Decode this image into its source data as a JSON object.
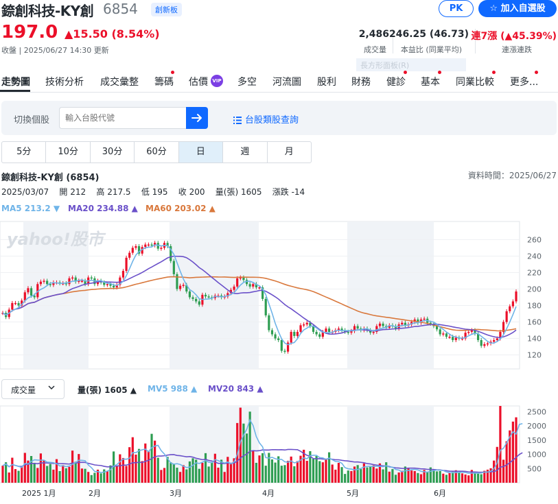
{
  "header": {
    "name": "錼創科技-KY創",
    "code": "6854",
    "board": "創新板",
    "pk": "PK",
    "add_watch": "☆ 加入自選股"
  },
  "quote": {
    "price": "197.0",
    "change": "▲15.50 (8.54%)",
    "updated": "收盤 | 2025/06/27 14:30 更新",
    "volume": "2,486",
    "volume_label": "成交量",
    "pe": "246.25 (46.73)",
    "pe_label": "本益比 (同業平均)",
    "streak": "連7漲 (▲45.39%)",
    "streak_label": "連漲連跌",
    "ghost": "長方形面板(R)"
  },
  "nav": [
    "走勢圖",
    "技術分析",
    "成交彙整",
    "籌碼",
    "估價",
    "多空",
    "河流圖",
    "股利",
    "財務",
    "健診",
    "基本",
    "同業比較",
    "更多..."
  ],
  "nav_vip": "VIP",
  "search": {
    "label": "切換個股",
    "placeholder": "輸入台股代號",
    "category_link": "台股類股查詢"
  },
  "ranges": [
    "5分",
    "10分",
    "30分",
    "60分",
    "日",
    "週",
    "月"
  ],
  "chart_head": {
    "title": "錼創科技-KY創 (6854)",
    "time": "資料時間：2025/06/27",
    "ohlc": "2025/03/07    開 212    高 217.5    低 195    收 200    量(張) 1605    漲跌 -14",
    "ma5": "MA5 213.2 ▼",
    "ma20": "MA20 234.88 ▲",
    "ma60": "MA60 203.02 ▲"
  },
  "volume_head": {
    "selector": "成交量",
    "vol": "量(張) 1605 ▲",
    "mv5": "MV5 988 ▲",
    "mv20": "MV20 843 ▲"
  },
  "watermark": "yahoo!股市",
  "colors": {
    "up": "#eb0f29",
    "down": "#2e9d52",
    "ma5": "#6fb4e8",
    "ma20": "#6a50c9",
    "ma60": "#d9783c",
    "accent": "#0f69ff"
  },
  "chart_data": [
    {
      "type": "candlestick",
      "title": "錼創科技-KY創 (6854)",
      "y_ticks": [
        120,
        140,
        160,
        180,
        200,
        220,
        240,
        260
      ],
      "ylim": [
        103,
        282
      ],
      "x_ticks": [
        "2025 1月",
        "2月",
        "3月",
        "4月",
        "5月",
        "6月"
      ],
      "close": [
        171,
        166,
        175,
        183,
        183,
        180,
        186,
        196,
        201,
        192,
        190,
        206,
        209,
        210,
        206,
        205,
        208,
        208,
        207,
        207,
        206,
        213,
        214,
        209,
        210,
        210,
        206,
        214,
        213,
        206,
        210,
        208,
        205,
        206,
        204,
        202,
        205,
        214,
        222,
        238,
        244,
        250,
        252,
        243,
        251,
        254,
        254,
        253,
        256,
        249,
        250,
        256,
        252,
        234,
        218,
        200,
        204,
        205,
        197,
        190,
        188,
        185,
        181,
        193,
        191,
        190,
        189,
        192,
        192,
        190,
        191,
        195,
        199,
        203,
        213,
        214,
        211,
        206,
        203,
        206,
        202,
        202,
        188,
        168,
        150,
        145,
        140,
        138,
        125,
        124,
        135,
        148,
        143,
        148,
        156,
        157,
        159,
        155,
        148,
        145,
        142,
        148,
        152,
        148,
        148,
        150,
        152,
        150,
        148,
        147,
        149,
        155,
        152,
        150,
        152,
        150,
        147,
        148,
        155,
        158,
        155,
        153,
        156,
        155,
        152,
        157,
        159,
        156,
        157,
        160,
        163,
        159,
        163,
        164,
        159,
        158,
        155,
        151,
        145,
        146,
        142,
        142,
        138,
        141,
        140,
        140,
        147,
        148,
        150,
        146,
        138,
        131,
        133,
        134,
        136,
        138,
        140,
        148,
        160,
        173,
        179,
        185,
        197
      ]
    },
    {
      "type": "bar",
      "title": "成交量",
      "y_ticks": [
        500,
        1000,
        1500,
        2000,
        2500
      ],
      "ylim": [
        0,
        2700
      ],
      "values": [
        600,
        720,
        360,
        880,
        480,
        420,
        560,
        1050,
        780,
        940,
        700,
        520,
        1030,
        780,
        590,
        660,
        460,
        830,
        410,
        620,
        510,
        560,
        1130,
        740,
        1010,
        500,
        490,
        380,
        270,
        350,
        460,
        330,
        470,
        420,
        610,
        1100,
        580,
        1000,
        870,
        590,
        1250,
        1600,
        990,
        1190,
        760,
        1380,
        1120,
        1720,
        1480,
        880,
        450,
        520,
        910,
        720,
        670,
        530,
        380,
        620,
        470,
        750,
        860,
        810,
        490,
        700,
        1040,
        570,
        730,
        1020,
        530,
        810,
        380,
        910,
        690,
        860,
        2100,
        2640,
        2080,
        1730,
        2500,
        1110,
        700,
        960,
        1040,
        600,
        1050,
        820,
        710,
        930,
        600,
        620,
        770,
        920,
        580,
        760,
        950,
        1160,
        770,
        1110,
        840,
        940,
        760,
        720,
        850,
        1070,
        640,
        460,
        700,
        550,
        310,
        430,
        410,
        570,
        620,
        480,
        680,
        540,
        560,
        610,
        500,
        680,
        470,
        720,
        390,
        480,
        280,
        360,
        420,
        570,
        520,
        430,
        410,
        340,
        300,
        450,
        370,
        540,
        480,
        400,
        410,
        320,
        280,
        360,
        380,
        440,
        350,
        330,
        290,
        260,
        450,
        380,
        320,
        300,
        420,
        460,
        510,
        780,
        1260,
        2700,
        810,
        1460,
        1840,
        2150,
        2300,
        2500,
        1605
      ]
    }
  ]
}
